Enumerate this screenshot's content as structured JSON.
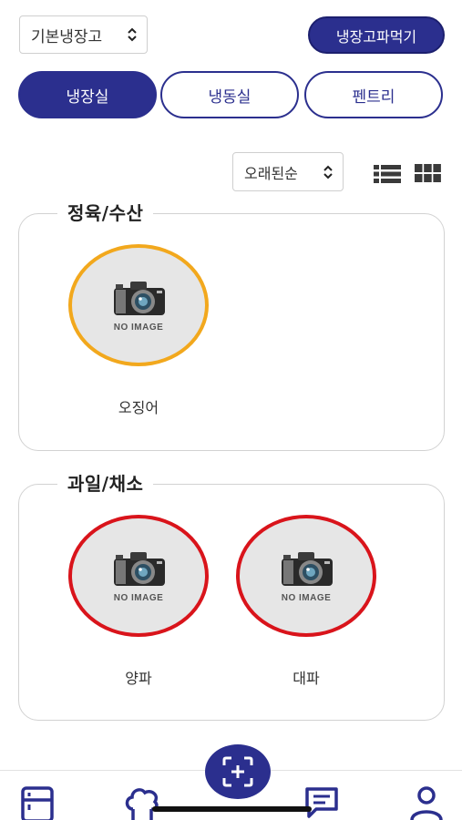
{
  "header": {
    "fridge_select": "기본냉장고",
    "eat_button": "냉장고파먹기"
  },
  "tabs": [
    {
      "label": "냉장실",
      "active": true
    },
    {
      "label": "냉동실",
      "active": false
    },
    {
      "label": "펜트리",
      "active": false
    }
  ],
  "sort": {
    "selected": "오래된순",
    "views": [
      "list-view-icon",
      "grid-view-icon"
    ]
  },
  "sections": [
    {
      "title": "정육/수산",
      "items": [
        {
          "name": "오징어",
          "placeholder": "NO IMAGE",
          "status_color": "#f2a81d"
        }
      ]
    },
    {
      "title": "과일/채소",
      "items": [
        {
          "name": "양파",
          "placeholder": "NO IMAGE",
          "status_color": "#d9141b"
        },
        {
          "name": "대파",
          "placeholder": "NO IMAGE",
          "status_color": "#d9141b"
        }
      ]
    }
  ],
  "colors": {
    "primary": "#2b2f8e",
    "warning": "#f2a81d",
    "danger": "#d9141b"
  },
  "bottom_nav": [
    "fridge-icon",
    "chef-hat-icon",
    "scan-add-icon",
    "chat-icon",
    "profile-icon"
  ]
}
